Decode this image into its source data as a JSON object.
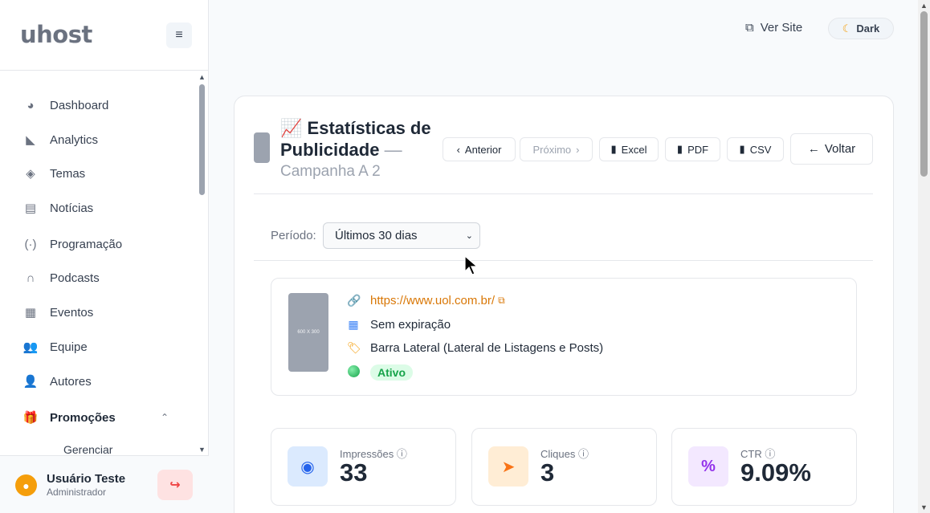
{
  "sidebar": {
    "logo": "uhost",
    "menu_icon": "hamburger-icon",
    "items": [
      {
        "label": "Dashboard",
        "icon": "palette-icon"
      },
      {
        "label": "Analytics",
        "icon": "chart-area-icon"
      },
      {
        "label": "Temas",
        "icon": "layers-icon"
      },
      {
        "label": "Notícias",
        "icon": "newspaper-icon"
      },
      {
        "label": "Programação",
        "icon": "broadcast-icon"
      },
      {
        "label": "Podcasts",
        "icon": "headphones-icon"
      },
      {
        "label": "Eventos",
        "icon": "calendar-icon"
      },
      {
        "label": "Equipe",
        "icon": "users-icon"
      },
      {
        "label": "Autores",
        "icon": "user-pen-icon"
      },
      {
        "label": "Promoções",
        "icon": "gift-icon"
      }
    ],
    "sub_items": [
      {
        "label": "Gerenciar"
      }
    ],
    "user": {
      "name": "Usuário Teste",
      "role": "Administrador"
    }
  },
  "topbar": {
    "ver_site": "Ver Site",
    "theme_toggle": "Dark"
  },
  "page": {
    "title": "Estatísticas de Publicidade",
    "dash": "—",
    "campaign": "Campanha A 2",
    "buttons": {
      "anterior": "Anterior",
      "proximo": "Próximo",
      "excel": "Excel",
      "pdf": "PDF",
      "csv": "CSV",
      "voltar": "Voltar"
    },
    "period": {
      "label": "Período:",
      "selected": "Últimos 30 dias"
    },
    "ad": {
      "thumb_label": "600 X 300",
      "url": "https://www.uol.com.br/",
      "expiration": "Sem expiração",
      "placement": "Barra Lateral (Lateral de Listagens e Posts)",
      "status": "Ativo"
    },
    "stats": [
      {
        "label": "Impressões",
        "value": "33",
        "icon": "eye-icon",
        "color": "#2563eb",
        "bg": "#dbeafe"
      },
      {
        "label": "Cliques",
        "value": "3",
        "icon": "pointer-icon",
        "color": "#f97316",
        "bg": "#ffedd5"
      },
      {
        "label": "CTR",
        "value": "9.09%",
        "icon": "percent-icon",
        "color": "#9333ea",
        "bg": "#f3e8ff"
      }
    ]
  }
}
